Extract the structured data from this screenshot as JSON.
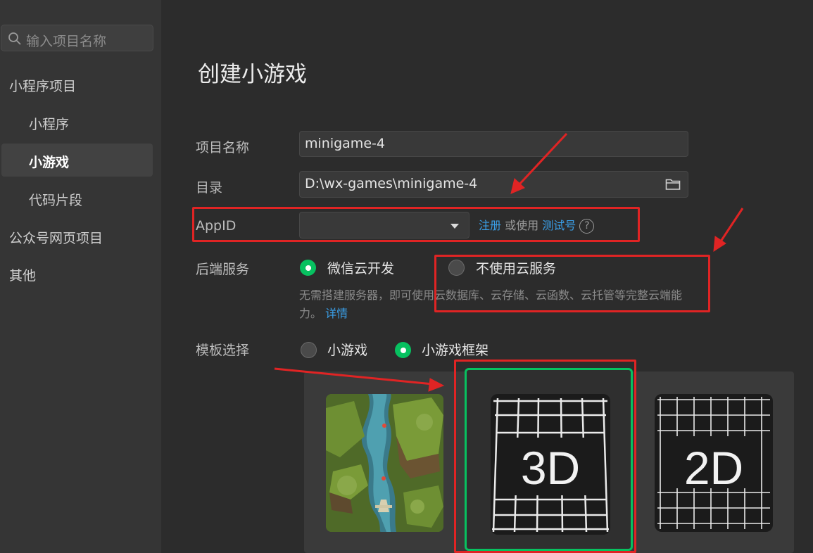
{
  "sidebar": {
    "search_placeholder": "输入项目名称",
    "groups": [
      {
        "label": "小程序项目"
      },
      {
        "label": "小程序"
      },
      {
        "label": "小游戏"
      },
      {
        "label": "代码片段"
      },
      {
        "label": "公众号网页项目"
      },
      {
        "label": "其他"
      }
    ],
    "active_item": "小游戏"
  },
  "main": {
    "title": "创建小游戏",
    "project_name": {
      "label": "项目名称",
      "value": "minigame-4"
    },
    "directory": {
      "label": "目录",
      "value": "D:\\wx-games\\minigame-4",
      "icon": "folder-icon"
    },
    "appid": {
      "label": "AppID",
      "value": "",
      "register_link": "注册",
      "or_use_text": "或使用",
      "test_account_link": "测试号",
      "help_glyph": "?"
    },
    "backend": {
      "label": "后端服务",
      "options": [
        {
          "label": "微信云开发",
          "selected": true
        },
        {
          "label": "不使用云服务",
          "selected": false
        }
      ],
      "description_line1": "无需搭建服务器，即可使用云数据库、云存储、云函数、云托管等完整云端能",
      "description_line2": "力。",
      "details_link": "详情"
    },
    "template": {
      "label": "模板选择",
      "options": [
        {
          "label": "小游戏",
          "selected": false
        },
        {
          "label": "小游戏框架",
          "selected": true
        }
      ],
      "cards": [
        {
          "name": "game-preview",
          "text": ""
        },
        {
          "name": "3d-template",
          "text": "3D",
          "selected": true
        },
        {
          "name": "2d-template",
          "text": "2D",
          "selected": false
        }
      ]
    }
  },
  "colors": {
    "accent_green": "#07c160",
    "link_blue": "#3a9fe8",
    "annotation_red": "#e02424"
  }
}
